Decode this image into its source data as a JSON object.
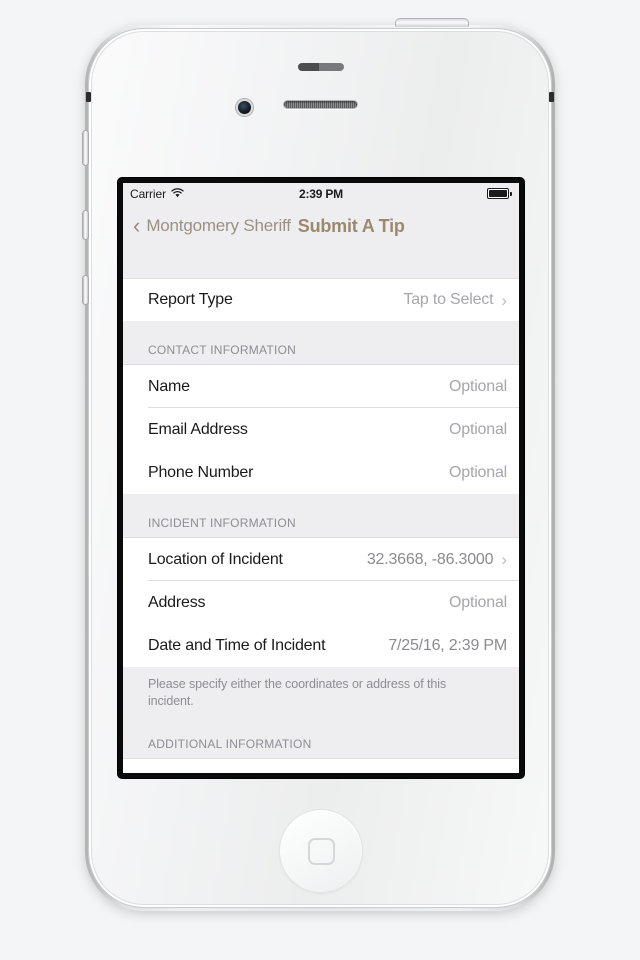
{
  "device": {
    "model_style": "iphone-white",
    "hardware": {
      "power_button": "power-button",
      "mute_switch": "mute-switch",
      "volume_up": "volume-up-button",
      "volume_down": "volume-down-button",
      "home_button": "home-button",
      "camera": "front-camera",
      "earpiece": "earpiece-speaker"
    }
  },
  "colors": {
    "accent_title": "#9c8a6f",
    "accent_back": "#9b9182",
    "row_value": "#a6a6ac",
    "section_text": "#8d8d93",
    "group_bg": "#eeeef1",
    "row_bg": "#ffffff",
    "separator": "#dededf"
  },
  "status_bar": {
    "carrier": "Carrier",
    "wifi_icon": "wifi-icon",
    "time": "2:39 PM",
    "battery_icon": "battery-full-icon"
  },
  "nav_bar": {
    "back_icon": "chevron-left-icon",
    "back_label": "Montgomery Sheriff",
    "title": "Submit A Tip"
  },
  "form": {
    "report_type_row": {
      "label": "Report Type",
      "value": "Tap to Select",
      "chevron": "chevron-right-icon"
    },
    "sections": [
      {
        "header": "CONTACT INFORMATION",
        "rows": [
          {
            "label": "Name",
            "value": "Optional",
            "chevron": null
          },
          {
            "label": "Email Address",
            "value": "Optional",
            "chevron": null
          },
          {
            "label": "Phone Number",
            "value": "Optional",
            "chevron": null
          }
        ],
        "footer": null
      },
      {
        "header": "INCIDENT INFORMATION",
        "rows": [
          {
            "label": "Location of Incident",
            "value": "32.3668, -86.3000",
            "chevron": "chevron-right-icon"
          },
          {
            "label": "Address",
            "value": "Optional",
            "chevron": null
          },
          {
            "label": "Date and Time of Incident",
            "value": "7/25/16, 2:39 PM",
            "chevron": null
          }
        ],
        "footer": "Please specify either the coordinates or address of this incident."
      },
      {
        "header": "ADDITIONAL INFORMATION",
        "rows": [],
        "footer": null
      }
    ]
  }
}
